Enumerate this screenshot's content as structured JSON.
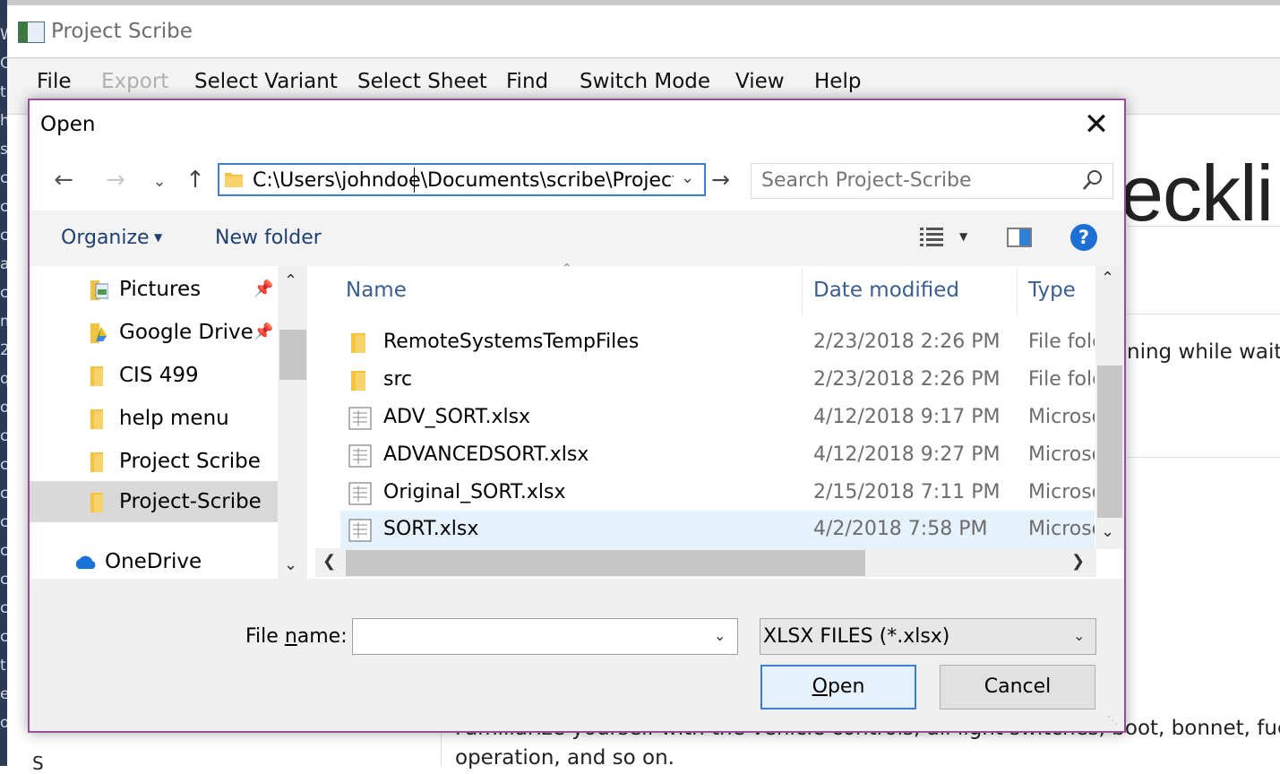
{
  "app": {
    "title": "Project Scribe",
    "menu": [
      "File",
      "Export",
      "Select Variant",
      "Select Sheet",
      "Find",
      "Switch Mode",
      "View",
      "Help"
    ],
    "heading_fragment": "eckli",
    "text_fragment_1": "ning while waitin",
    "text_fragment_2": "Familiarize yourself with the vehicle controls, all light switches, boot, bonnet, fuel cap",
    "text_fragment_3": "operation, and so on.",
    "text_fragment_4": "S",
    "left_strip_chars": "W O t h s c c c a c m 2 q o c c c c c c c c t e o"
  },
  "dialog": {
    "title": "Open",
    "close_glyph": "✕",
    "address_path": "C:\\Users\\johndoe\\Documents\\scribe\\Project-Scribe",
    "search_placeholder": "Search Project-Scribe",
    "organize_label": "Organize",
    "new_folder_label": "New folder",
    "help_glyph": "?",
    "nav_items": [
      {
        "label": "Pictures",
        "pinned": true,
        "icon": "pictures-folder-icon"
      },
      {
        "label": "Google Drive",
        "pinned": true,
        "icon": "google-drive-folder-icon"
      },
      {
        "label": "CIS 499",
        "pinned": false,
        "icon": "folder-icon"
      },
      {
        "label": "help menu",
        "pinned": false,
        "icon": "folder-icon"
      },
      {
        "label": "Project Scribe",
        "pinned": false,
        "icon": "folder-icon"
      },
      {
        "label": "Project-Scribe",
        "pinned": false,
        "icon": "folder-icon",
        "selected": true
      },
      {
        "label": "OneDrive",
        "pinned": false,
        "icon": "onedrive-cloud-icon"
      }
    ],
    "columns": {
      "name": "Name",
      "date": "Date modified",
      "type": "Type"
    },
    "files": [
      {
        "name": "RemoteSystemsTempFiles",
        "date": "2/23/2018 2:26 PM",
        "type": "File folder",
        "kind": "folder"
      },
      {
        "name": "src",
        "date": "2/23/2018 2:26 PM",
        "type": "File folder",
        "kind": "folder"
      },
      {
        "name": "ADV_SORT.xlsx",
        "date": "4/12/2018 9:17 PM",
        "type": "Microsoft",
        "kind": "file"
      },
      {
        "name": "ADVANCEDSORT.xlsx",
        "date": "4/12/2018 9:27 PM",
        "type": "Microsoft",
        "kind": "file"
      },
      {
        "name": "Original_SORT.xlsx",
        "date": "2/15/2018 7:11 PM",
        "type": "Microsoft",
        "kind": "file"
      },
      {
        "name": "SORT.xlsx",
        "date": "4/2/2018 7:58 PM",
        "type": "Microsoft",
        "kind": "file",
        "selected": true
      }
    ],
    "file_name_label_pre": "File ",
    "file_name_label_u": "n",
    "file_name_label_post": "ame:",
    "file_name_value": "",
    "filter_value": "XLSX FILES (*.xlsx)",
    "open_label_u": "O",
    "open_label_rest": "pen",
    "cancel_label": "Cancel"
  },
  "colors": {
    "accent": "#3c7fd5",
    "dialog_border": "#9b4d9b",
    "folder": "#f5c342",
    "selected_row": "#e5f1fb"
  }
}
